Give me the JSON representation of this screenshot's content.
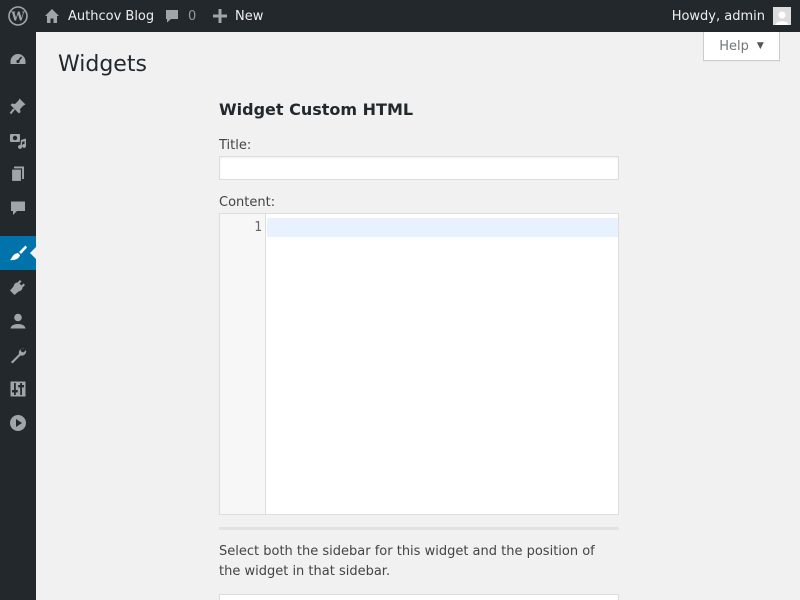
{
  "adminbar": {
    "site_name": "Authcov Blog",
    "comments_count": "0",
    "new_label": "New",
    "greeting": "Howdy, admin"
  },
  "sidebar": {
    "items": [
      {
        "icon": "dashboard-icon",
        "current": false
      },
      {
        "icon": "pin-icon",
        "current": false
      },
      {
        "icon": "media-icon",
        "current": false
      },
      {
        "icon": "pages-icon",
        "current": false
      },
      {
        "icon": "comments-icon",
        "current": false
      },
      {
        "icon": "appearance-icon",
        "current": true
      },
      {
        "icon": "plugins-icon",
        "current": false
      },
      {
        "icon": "users-icon",
        "current": false
      },
      {
        "icon": "tools-icon",
        "current": false
      },
      {
        "icon": "settings-icon",
        "current": false
      },
      {
        "icon": "play-icon",
        "current": false
      }
    ]
  },
  "help_tab": {
    "label": "Help"
  },
  "page": {
    "title": "Widgets"
  },
  "widget": {
    "heading": "Widget Custom HTML",
    "title_label": "Title:",
    "title_value": "",
    "content_label": "Content:",
    "editor_line_number": "1",
    "sidebar_help": "Select both the sidebar for this widget and the position of the widget in that sidebar."
  },
  "colors": {
    "adminbar_bg": "#23282d",
    "menu_current": "#0073aa",
    "page_bg": "#f1f1f1",
    "active_line": "#e8f2ff"
  }
}
